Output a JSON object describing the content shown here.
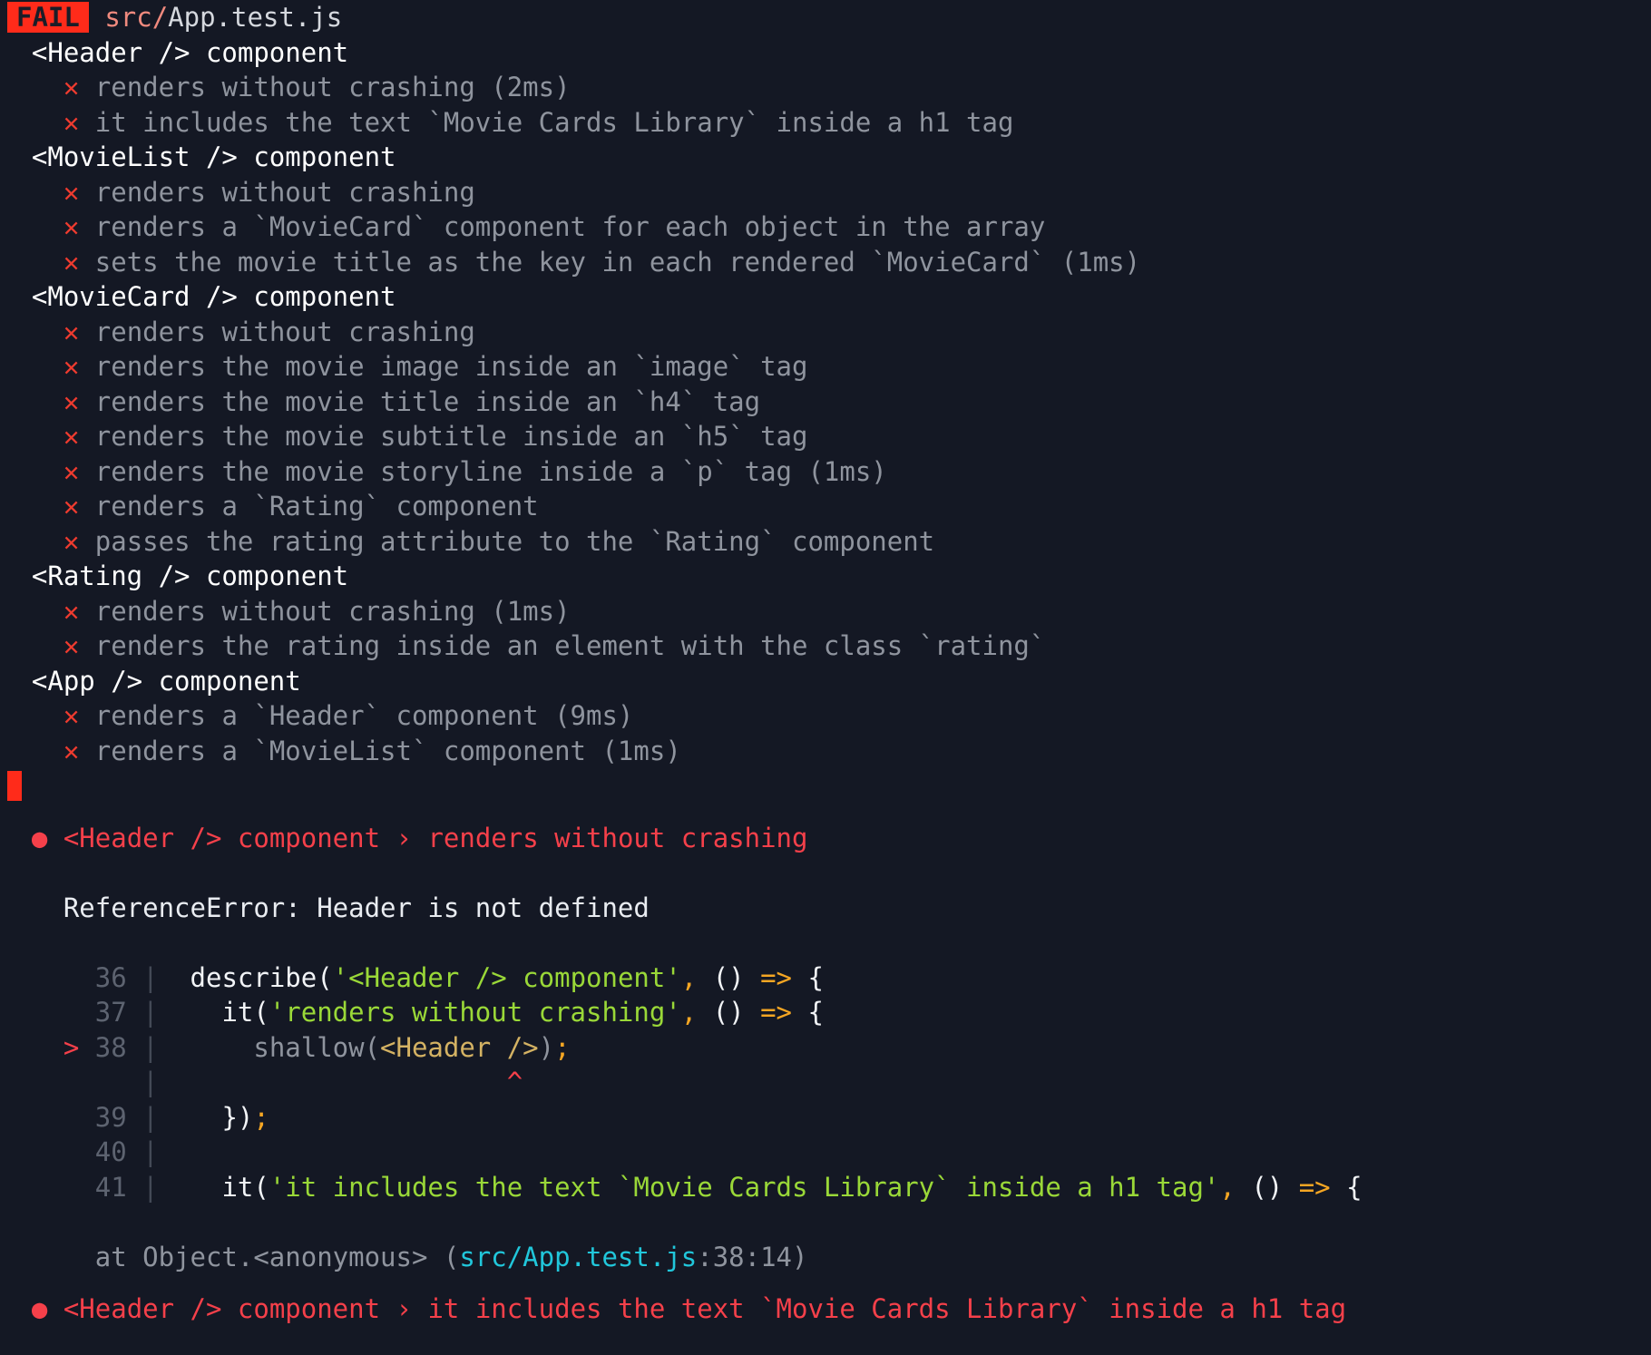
{
  "terminal": {
    "background_color": "#141824",
    "title": "Jest test run output"
  },
  "header": {
    "status_badge": "FAIL",
    "status_badge_bg": "#ff2b1a",
    "path_dir": "src/",
    "path_file": "App.test.js"
  },
  "icons": {
    "cross": "✕",
    "bullet": "●",
    "chevron": "›",
    "arrow_marker": ">",
    "caret": "^",
    "pipe": "|"
  },
  "suites": [
    {
      "name": "<Header /> component",
      "tests": [
        {
          "status": "fail",
          "label": "renders without crashing (2ms)"
        },
        {
          "status": "fail",
          "label": "it includes the text `Movie Cards Library` inside a h1 tag"
        }
      ]
    },
    {
      "name": "<MovieList /> component",
      "tests": [
        {
          "status": "fail",
          "label": "renders without crashing"
        },
        {
          "status": "fail",
          "label": "renders a `MovieCard` component for each object in the array"
        },
        {
          "status": "fail",
          "label": "sets the movie title as the key in each rendered `MovieCard` (1ms)"
        }
      ]
    },
    {
      "name": "<MovieCard /> component",
      "tests": [
        {
          "status": "fail",
          "label": "renders without crashing"
        },
        {
          "status": "fail",
          "label": "renders the movie image inside an `image` tag"
        },
        {
          "status": "fail",
          "label": "renders the movie title inside an `h4` tag"
        },
        {
          "status": "fail",
          "label": "renders the movie subtitle inside an `h5` tag"
        },
        {
          "status": "fail",
          "label": "renders the movie storyline inside a `p` tag (1ms)"
        },
        {
          "status": "fail",
          "label": "renders a `Rating` component"
        },
        {
          "status": "fail",
          "label": "passes the rating attribute to the `Rating` component"
        }
      ]
    },
    {
      "name": "<Rating /> component",
      "tests": [
        {
          "status": "fail",
          "label": "renders without crashing (1ms)"
        },
        {
          "status": "fail",
          "label": "renders the rating inside an element with the class `rating`"
        }
      ]
    },
    {
      "name": "<App /> component",
      "tests": [
        {
          "status": "fail",
          "label": "renders a `Header` component (9ms)"
        },
        {
          "status": "fail",
          "label": "renders a `MovieList` component (1ms)"
        }
      ]
    }
  ],
  "failure_details": [
    {
      "suite": "<Header /> component",
      "separator": "›",
      "test": "renders without crashing",
      "error_message": "ReferenceError: Header is not defined",
      "code_frame": [
        {
          "marker": "",
          "number": "36",
          "segments": [
            {
              "text": "  describe(",
              "style": "code"
            },
            {
              "text": "'<Header /> component'",
              "style": "string"
            },
            {
              "text": ",",
              "style": "punct"
            },
            {
              "text": " ()",
              "style": "code"
            },
            {
              "text": " =>",
              "style": "punct"
            },
            {
              "text": " {",
              "style": "code"
            }
          ]
        },
        {
          "marker": "",
          "number": "37",
          "segments": [
            {
              "text": "    it(",
              "style": "code"
            },
            {
              "text": "'renders without crashing'",
              "style": "string"
            },
            {
              "text": ",",
              "style": "punct"
            },
            {
              "text": " ()",
              "style": "code"
            },
            {
              "text": " =>",
              "style": "punct"
            },
            {
              "text": " {",
              "style": "code"
            }
          ]
        },
        {
          "marker": ">",
          "number": "38",
          "segments": [
            {
              "text": "      shallow(",
              "style": "dim"
            },
            {
              "text": "<Header />",
              "style": "jsx"
            },
            {
              "text": ")",
              "style": "dim"
            },
            {
              "text": ";",
              "style": "punct"
            }
          ]
        },
        {
          "marker": "",
          "number": "",
          "caret": "^",
          "caret_column": 22,
          "segments": []
        },
        {
          "marker": "",
          "number": "39",
          "segments": [
            {
              "text": "    })",
              "style": "code"
            },
            {
              "text": ";",
              "style": "punct"
            }
          ]
        },
        {
          "marker": "",
          "number": "40",
          "segments": []
        },
        {
          "marker": "",
          "number": "41",
          "segments": [
            {
              "text": "    it(",
              "style": "code"
            },
            {
              "text": "'it includes the text `Movie Cards Library` inside a h1 tag'",
              "style": "string"
            },
            {
              "text": ",",
              "style": "punct"
            },
            {
              "text": " ()",
              "style": "code"
            },
            {
              "text": " =>",
              "style": "punct"
            },
            {
              "text": " {",
              "style": "code"
            }
          ]
        }
      ],
      "stack": {
        "prefix": "at Object.<anonymous> (",
        "file": "src/App.test.js",
        "location": ":38:14)"
      }
    },
    {
      "suite": "<Header /> component",
      "separator": "›",
      "test": "it includes the text `Movie Cards Library` inside a h1 tag",
      "error_message": "",
      "code_frame": [],
      "stack": null
    }
  ],
  "cursor": {
    "visible": true,
    "color": "#ff2b1a"
  }
}
